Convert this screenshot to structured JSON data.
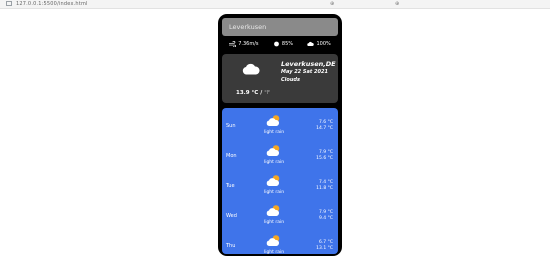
{
  "browser": {
    "tab_text": "127.0.0.1:5500/index.html",
    "right_text_1": "⊕",
    "right_text_2": "⊕"
  },
  "search": {
    "value": "Leverkusen"
  },
  "stats": {
    "wind": "7.36m/s",
    "humidity": "85%",
    "clouds": "100%"
  },
  "current": {
    "temp_c": "13.9 °C",
    "separator": " / ",
    "temp_f": "°F",
    "city": "Leverkusen,DE",
    "date": "May 22 Sat 2021",
    "condition": "Clouds"
  },
  "forecast": [
    {
      "day": "Sun",
      "desc": "light rain",
      "hi": "7.6 °C",
      "lo": "14.7 °C"
    },
    {
      "day": "Mon",
      "desc": "light rain",
      "hi": "7.9 °C",
      "lo": "15.6 °C"
    },
    {
      "day": "Tue",
      "desc": "light rain",
      "hi": "7.4 °C",
      "lo": "11.8 °C"
    },
    {
      "day": "Wed",
      "desc": "light rain",
      "hi": "7.9 °C",
      "lo": "9.4 °C"
    },
    {
      "day": "Thu",
      "desc": "light rain",
      "hi": "6.7 °C",
      "lo": "13.1 °C"
    }
  ],
  "colors": {
    "forecast_bg": "#3f74ea",
    "current_bg": "#3a3a3a",
    "search_bg": "#8a8a8a",
    "sun": "#f5a623"
  },
  "icons": {
    "wind": "wind-icon",
    "humidity": "humidity-icon",
    "clouds": "cloud-icon",
    "current": "cloud-icon",
    "forecast": "sun-cloud-icon"
  }
}
